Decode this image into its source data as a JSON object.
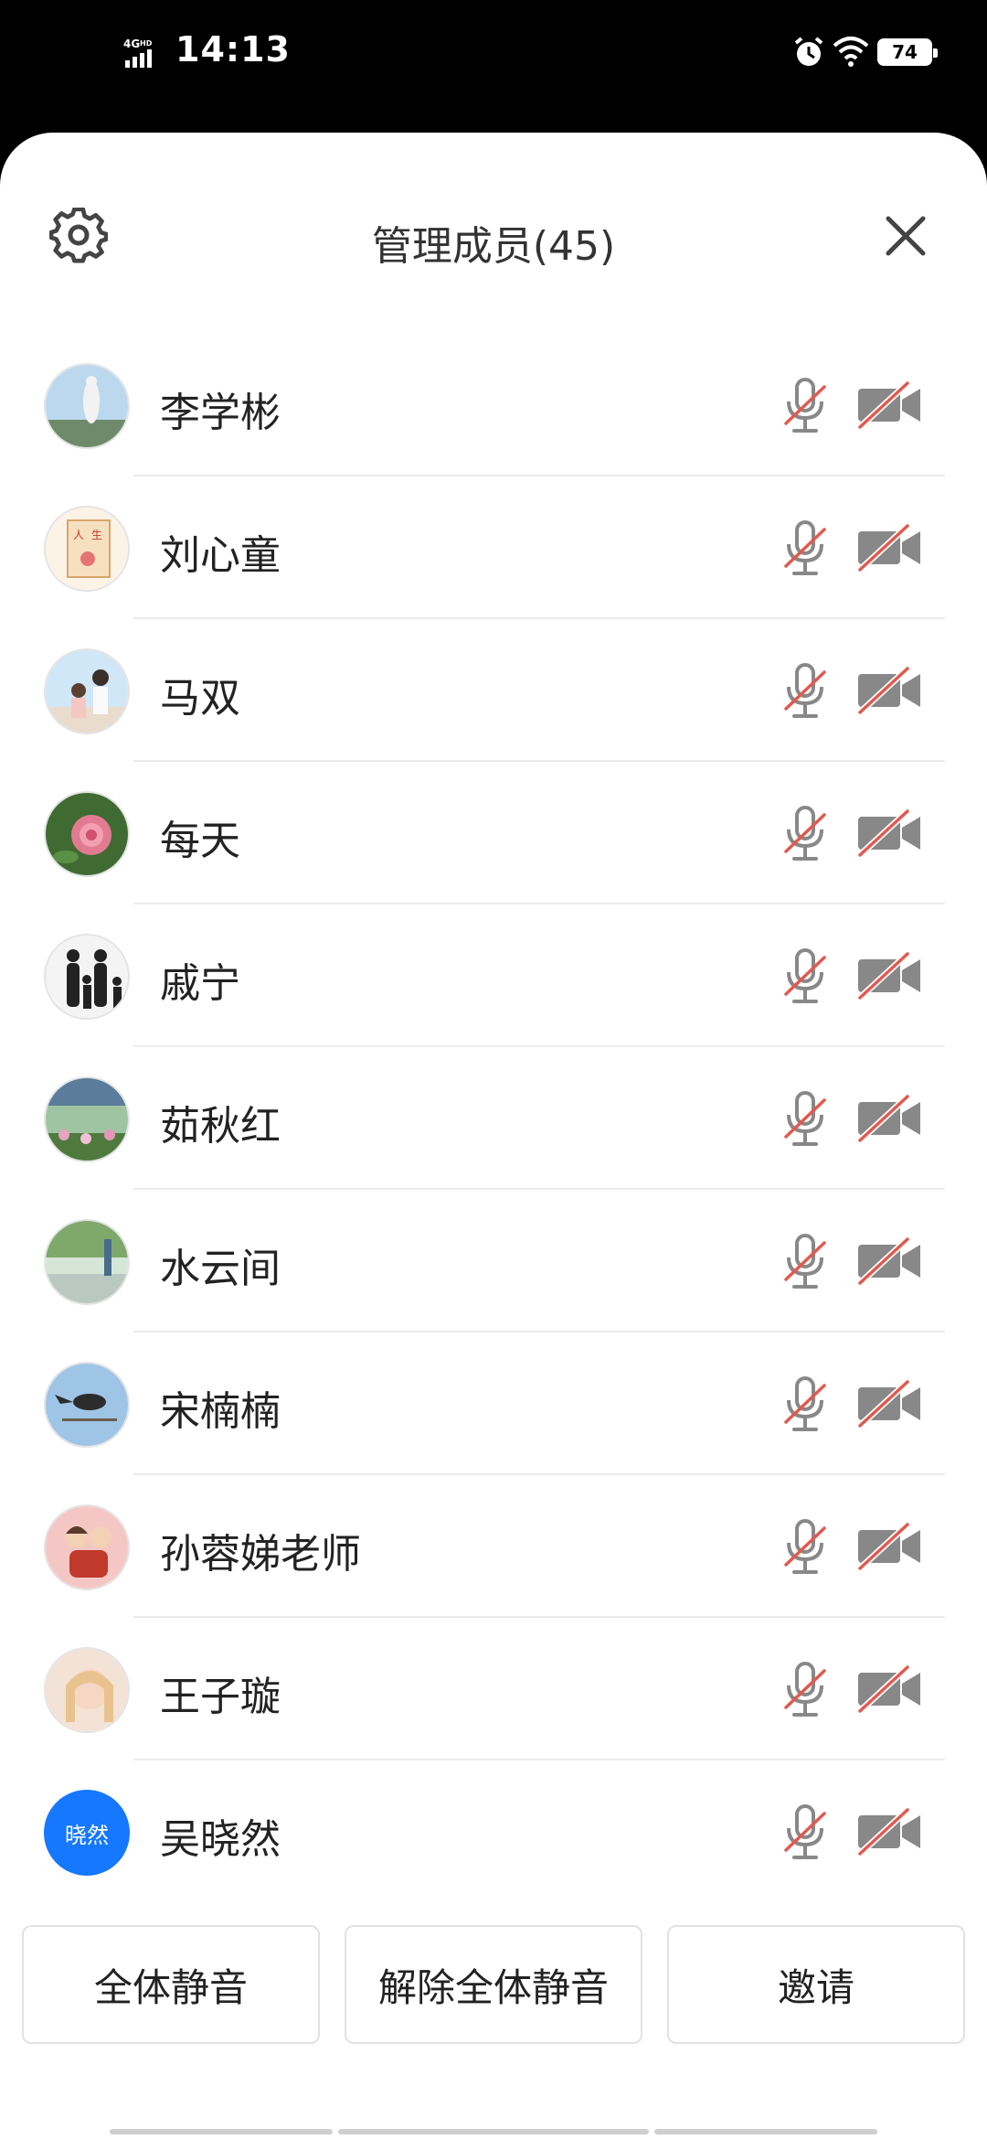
{
  "status_bar": {
    "network": "4G HD",
    "time": "14:13",
    "battery": "74"
  },
  "header": {
    "title": "管理成员(45)"
  },
  "members": [
    {
      "name": "李学彬",
      "avatar": "photo-statue"
    },
    {
      "name": "刘心童",
      "avatar": "photo-poster"
    },
    {
      "name": "马双",
      "avatar": "photo-couple"
    },
    {
      "name": "每天",
      "avatar": "photo-rose"
    },
    {
      "name": "戚宁",
      "avatar": "photo-family-silhouette"
    },
    {
      "name": "茹秋红",
      "avatar": "photo-garden"
    },
    {
      "name": "水云间",
      "avatar": "photo-landscape"
    },
    {
      "name": "宋楠楠",
      "avatar": "photo-bird"
    },
    {
      "name": "孙蓉娣老师",
      "avatar": "photo-cartoon-family"
    },
    {
      "name": "王子璇",
      "avatar": "photo-portrait"
    },
    {
      "name": "吴晓然",
      "avatar_text": "晓然"
    }
  ],
  "actions": {
    "mute_all": "全体静音",
    "unmute_all": "解除全体静音",
    "invite": "邀请"
  },
  "colors": {
    "accent": "#1677ff",
    "muted_slash": "#e05a4f",
    "icon_gray": "#888888"
  }
}
